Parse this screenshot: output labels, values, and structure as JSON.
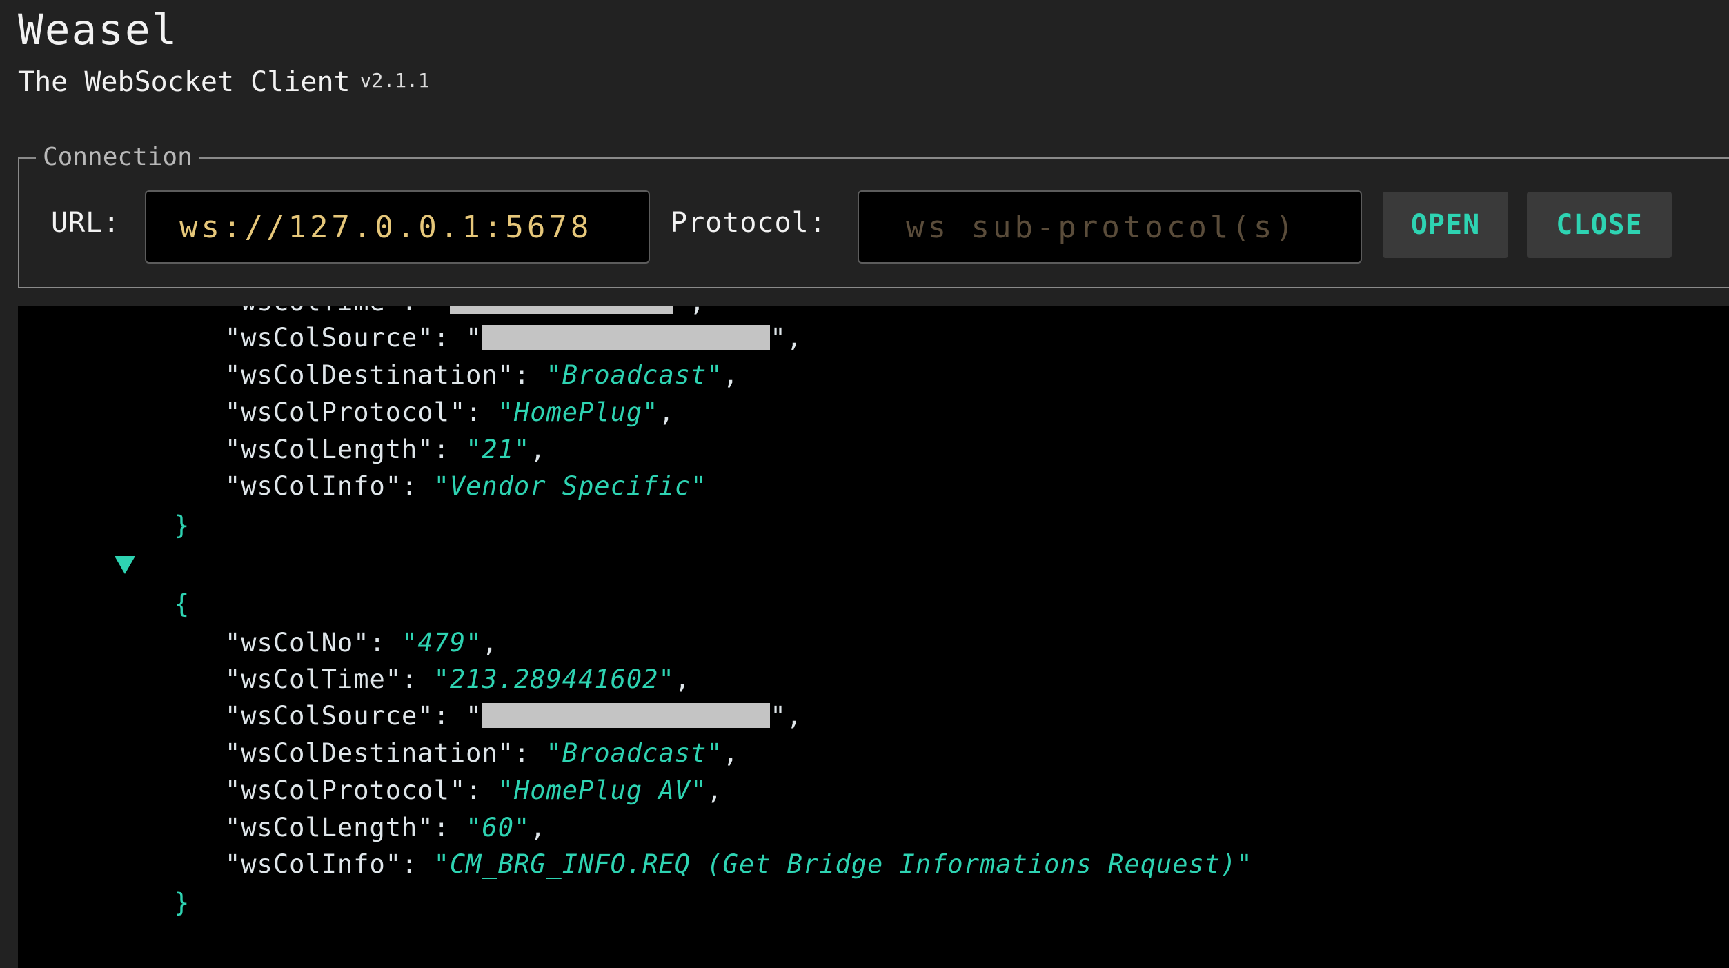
{
  "app": {
    "title": "Weasel",
    "subtitle": "The WebSocket Client",
    "version": "v2.1.1"
  },
  "connection": {
    "legend": "Connection",
    "url_label": "URL:",
    "url_value": "ws://127.0.0.1:5678",
    "protocol_label": "Protocol:",
    "protocol_placeholder": "ws sub-protocol(s)",
    "open_label": "OPEN",
    "close_label": "CLOSE"
  },
  "log": {
    "partial_key": "\"wsColTime\": \"",
    "record_1": {
      "source_key": "\"wsColSource\": \"",
      "destination_key": "\"wsColDestination\": ",
      "destination": "\"Broadcast\"",
      "protocol_key": "\"wsColProtocol\": ",
      "protocol": "\"HomePlug\"",
      "length_key": "\"wsColLength\": ",
      "length": "\"21\"",
      "info_key": "\"wsColInfo\": ",
      "info": "\"Vendor Specific\""
    },
    "record_2": {
      "no_key": "\"wsColNo\": ",
      "no": "\"479\"",
      "time_key": "\"wsColTime\": ",
      "time": "\"213.289441602\"",
      "source_key": "\"wsColSource\": \"",
      "destination_key": "\"wsColDestination\": ",
      "destination": "\"Broadcast\"",
      "protocol_key": "\"wsColProtocol\": ",
      "protocol": "\"HomePlug AV\"",
      "length_key": "\"wsColLength\": ",
      "length": "\"60\"",
      "info_key": "\"wsColInfo\": ",
      "info": "\"CM_BRG_INFO.REQ (Get Bridge Informations Request)\""
    },
    "open_brace": "{",
    "close_brace": "}",
    "comma": ",",
    "quote_comma": "\","
  },
  "colors": {
    "accent": "#2ed3b2",
    "url_text": "#e6c77a",
    "background": "#222222",
    "log_background": "#000000"
  },
  "icons": {
    "expand_toggle": "triangle-down-icon"
  }
}
